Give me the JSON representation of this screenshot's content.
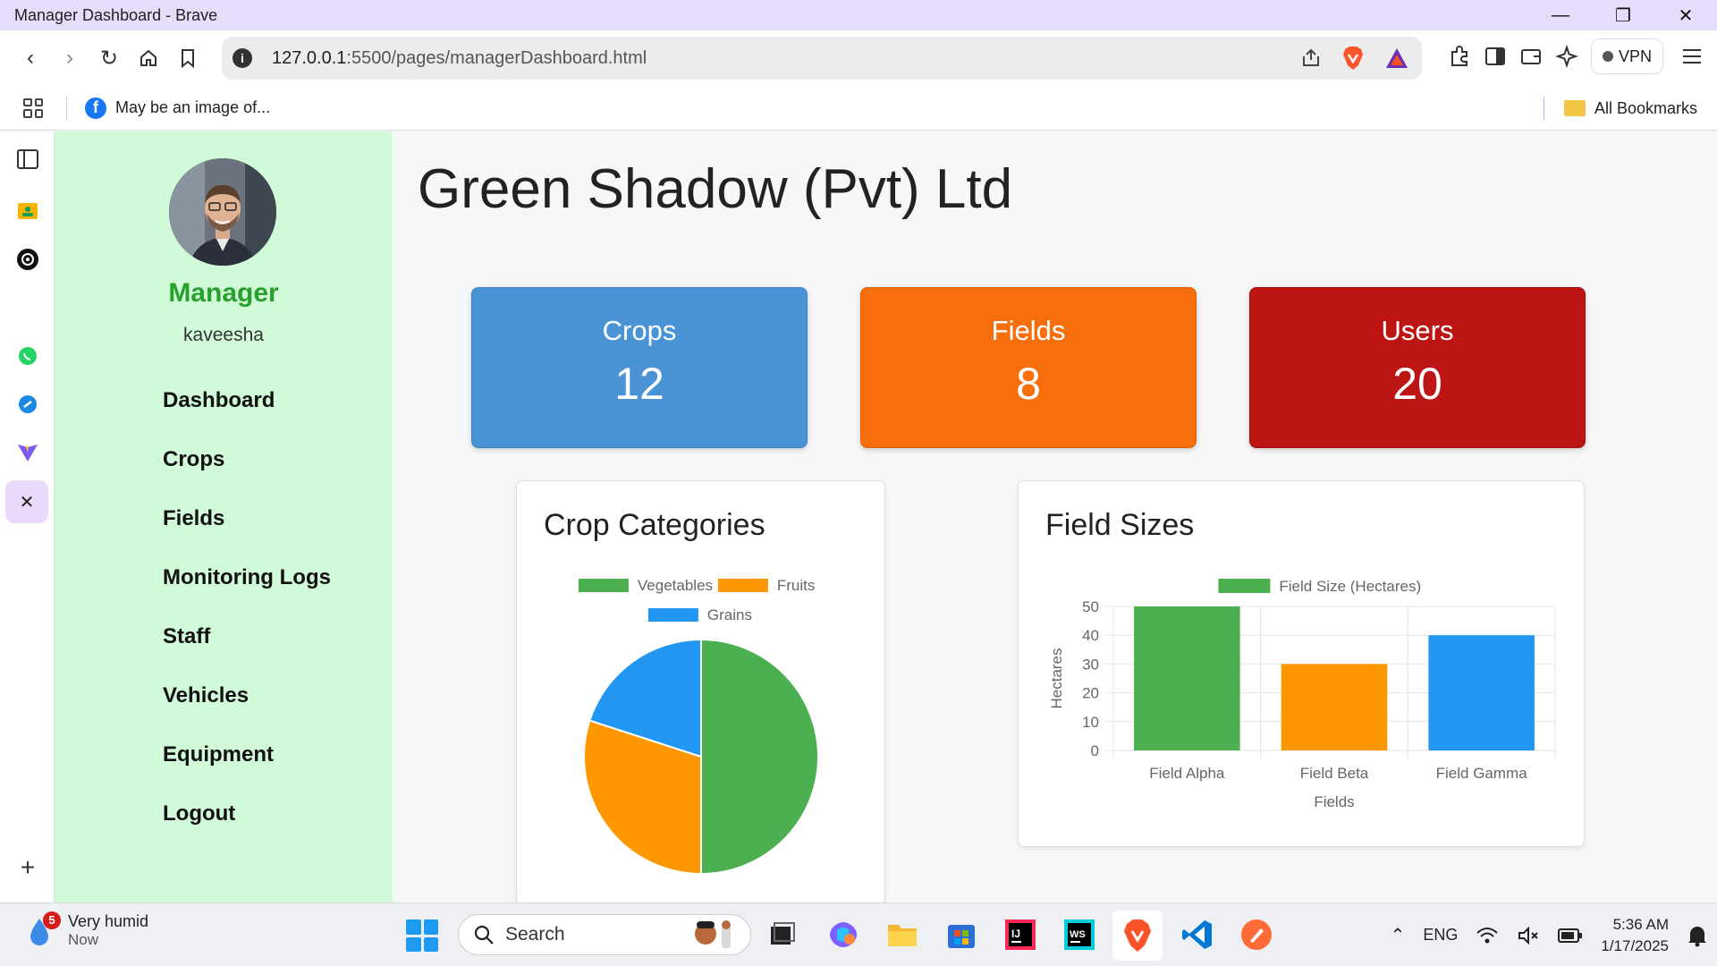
{
  "window": {
    "title": "Manager Dashboard - Brave"
  },
  "browser": {
    "url_host": "127.0.0.1",
    "url_path": ":5500/pages/managerDashboard.html",
    "vpn_label": "VPN",
    "bookmark_label": "May be an image of...",
    "all_bookmarks_label": "All Bookmarks"
  },
  "sidebar": {
    "role": "Manager",
    "username": "kaveesha",
    "menu": [
      {
        "label": "Dashboard"
      },
      {
        "label": "Crops"
      },
      {
        "label": "Fields"
      },
      {
        "label": "Monitoring Logs"
      },
      {
        "label": "Staff"
      },
      {
        "label": "Vehicles"
      },
      {
        "label": "Equipment"
      },
      {
        "label": "Logout"
      }
    ]
  },
  "main": {
    "title": "Green Shadow (Pvt) Ltd",
    "stats": [
      {
        "label": "Crops",
        "value": "12",
        "color": "#4a94d6"
      },
      {
        "label": "Fields",
        "value": "8",
        "color": "#f76f0c"
      },
      {
        "label": "Users",
        "value": "20",
        "color": "#bd1414"
      }
    ]
  },
  "chart_data": [
    {
      "type": "pie",
      "title": "Crop Categories",
      "categories": [
        "Vegetables",
        "Fruits",
        "Grains"
      ],
      "values": [
        50,
        30,
        20
      ],
      "colors": [
        "#4caf50",
        "#ff9800",
        "#2196f3"
      ],
      "legend": "top"
    },
    {
      "type": "bar",
      "title": "Field Sizes",
      "categories": [
        "Field Alpha",
        "Field Beta",
        "Field Gamma"
      ],
      "series": [
        {
          "name": "Field Size (Hectares)",
          "values": [
            50,
            30,
            40
          ]
        }
      ],
      "colors": [
        "#4caf50",
        "#ff9800",
        "#2196f3"
      ],
      "xlabel": "Fields",
      "ylabel": "Hectares",
      "ylim": [
        0,
        50
      ],
      "yticks": [
        "0",
        "10",
        "20",
        "30",
        "40",
        "50"
      ],
      "grid": true,
      "legend": "top"
    }
  ],
  "taskbar": {
    "weather_text": "Very humid",
    "weather_sub": "Now",
    "notification_count": "5",
    "search_placeholder": "Search",
    "language": "ENG",
    "time": "5:36 AM",
    "date": "1/17/2025"
  }
}
